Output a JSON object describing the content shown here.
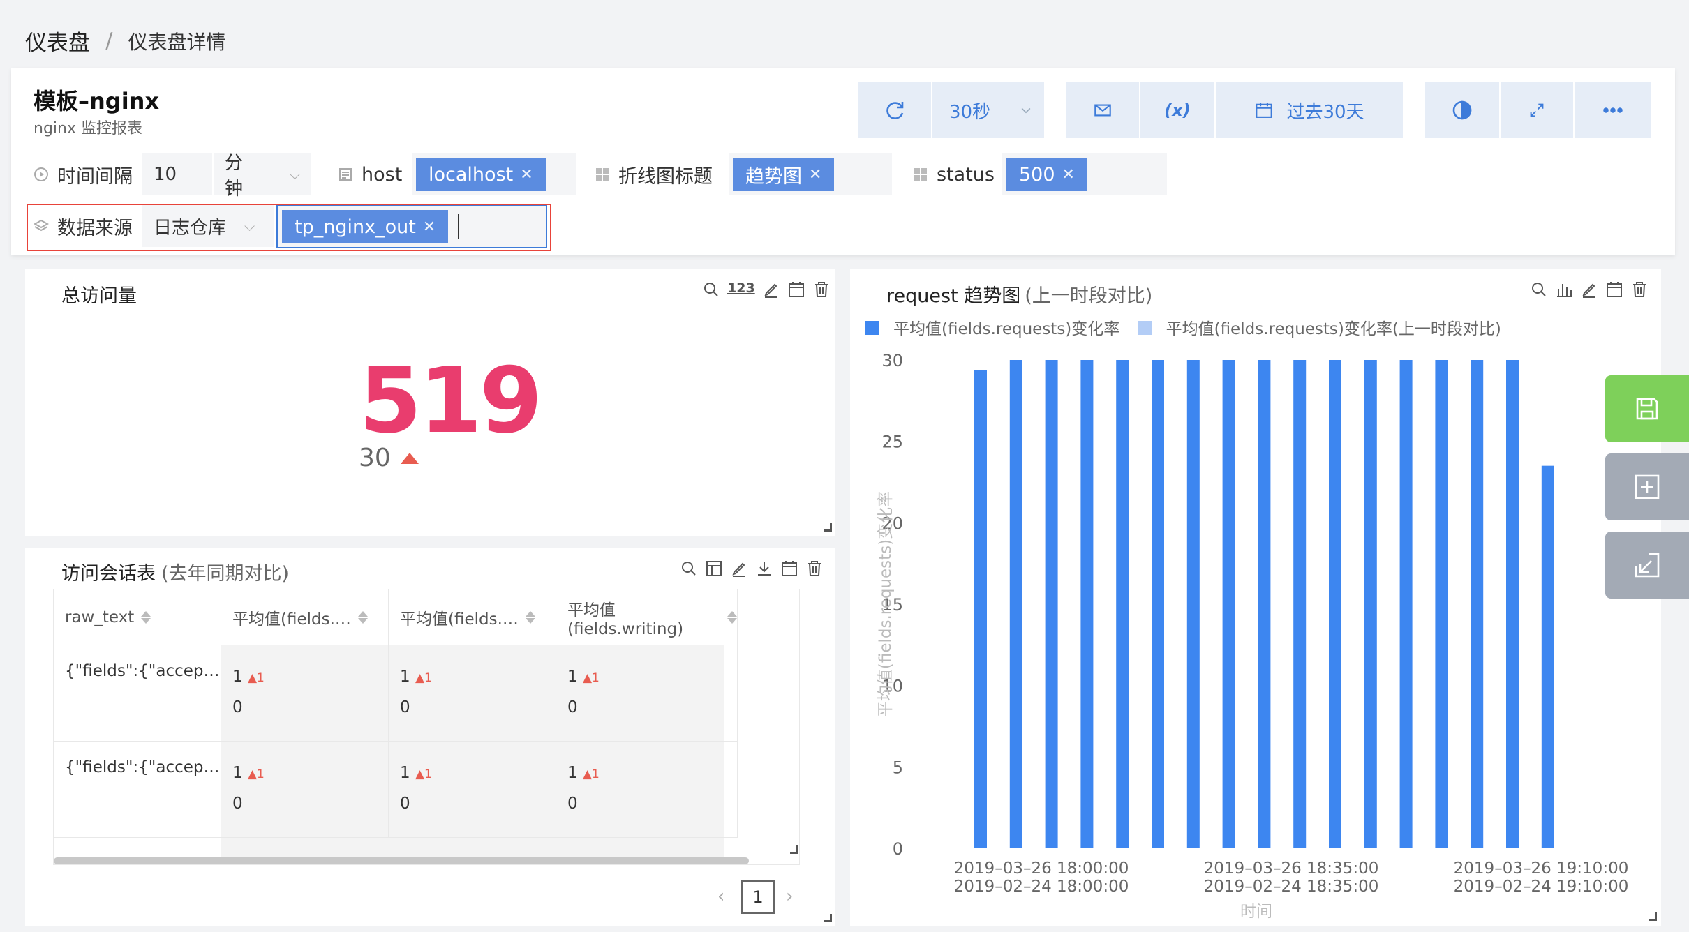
{
  "breadcrumb": {
    "root": "仪表盘",
    "sep": "/",
    "current": "仪表盘详情"
  },
  "header": {
    "title": "模板–nginx",
    "subtitle": "nginx 监控报表"
  },
  "toolbar": {
    "refresh_interval": "30秒",
    "var_label": "(x)",
    "time_range": "过去30天"
  },
  "filters": {
    "interval_label": "时间间隔",
    "interval_value": "10",
    "interval_unit": "分钟",
    "host_label": "host",
    "host_tag": "localhost",
    "chart_title_label": "折线图标题",
    "chart_title_tag": "趋势图",
    "status_label": "status",
    "status_tag": "500",
    "source_label": "数据来源",
    "source_value": "日志仓库",
    "source_tag": "tp_nginx_out"
  },
  "kpi_card": {
    "title": "总访问量",
    "value": "519",
    "compare": "30"
  },
  "table_card": {
    "title": "访问会话表",
    "title_suffix": "(去年同期对比)",
    "columns": [
      "raw_text",
      "平均值(fields.…",
      "平均值(fields.…",
      "平均值(fields.writing)"
    ],
    "rows": [
      {
        "raw": "{\"fields\":{\"accep…",
        "c1": "1",
        "c1d": "1",
        "c1p": "0",
        "c2": "1",
        "c2d": "1",
        "c2p": "0",
        "c3": "1",
        "c3d": "1",
        "c3p": "0"
      },
      {
        "raw": "{\"fields\":{\"accep…",
        "c1": "1",
        "c1d": "1",
        "c1p": "0",
        "c2": "1",
        "c2d": "1",
        "c2p": "0",
        "c3": "1",
        "c3d": "1",
        "c3p": "0"
      }
    ],
    "page": "1"
  },
  "chart_card": {
    "title": "request 趋势图",
    "title_suffix": "(上一时段对比)"
  },
  "chart_data": {
    "type": "bar",
    "legend": [
      "平均值(fields.requests)变化率",
      "平均值(fields.requests)变化率(上一时段对比)"
    ],
    "legend_colors": [
      "#3d86f0",
      "#b3cdf6"
    ],
    "ylabel": "平均值(fields.requests)变化率",
    "xlabel": "时间",
    "ylim": [
      0,
      30
    ],
    "yticks": [
      0,
      5,
      10,
      15,
      20,
      25,
      30
    ],
    "xticks": [
      [
        "2019–03–26 18:00:00",
        "2019–02–24 18:00:00"
      ],
      [
        "2019–03–26 18:35:00",
        "2019–02–24 18:35:00"
      ],
      [
        "2019–03–26 19:10:00",
        "2019–02–24 19:10:00"
      ]
    ],
    "series": [
      {
        "values": [
          29.4,
          30,
          30,
          30,
          30,
          30,
          30,
          30,
          30,
          30,
          30,
          30,
          30,
          30,
          30,
          30,
          23.5
        ]
      }
    ],
    "legend_position": "top-left",
    "grid": false
  }
}
